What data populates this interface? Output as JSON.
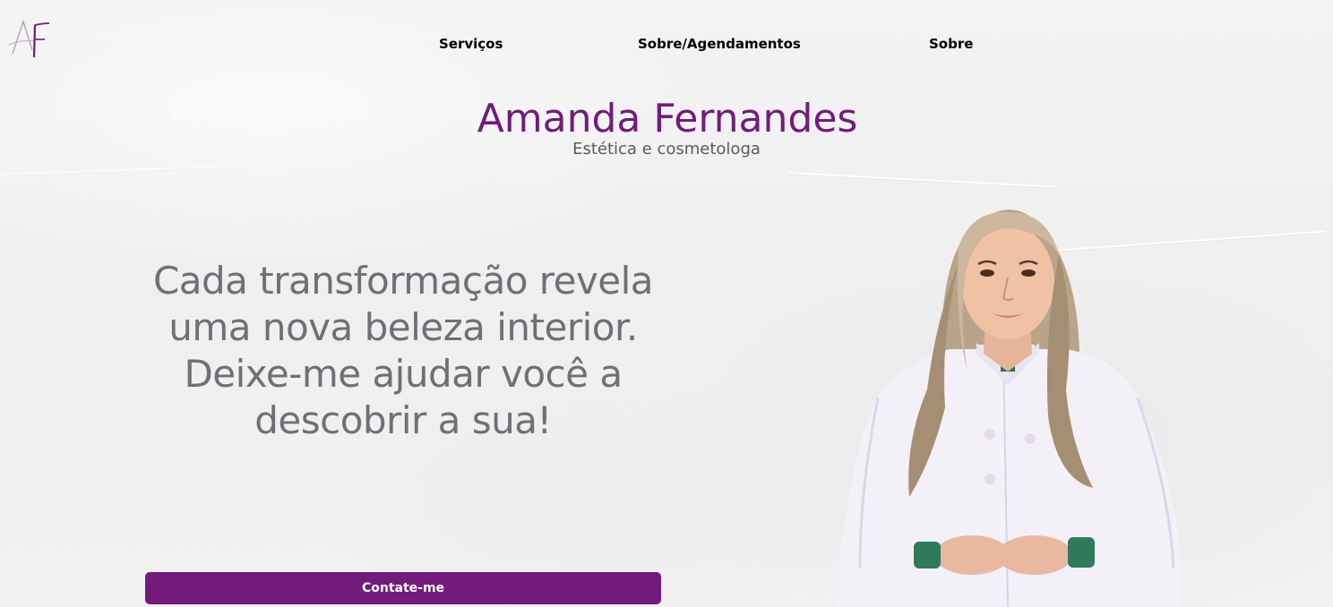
{
  "logo": {
    "text": "AF",
    "icon": "af-monogram-logo"
  },
  "nav": {
    "items": [
      {
        "label": "Serviços"
      },
      {
        "label": "Sobre/Agendamentos"
      },
      {
        "label": "Sobre"
      }
    ]
  },
  "hero": {
    "name": "Amanda Fernandes",
    "subtitle": "Estética e cosmetologa",
    "tagline": "Cada transformação revela uma nova beleza interior. Deixe-me ajudar você a descobrir a sua!",
    "cta_label": "Contate-me"
  },
  "colors": {
    "brand_purple": "#731b7a",
    "tagline_gray": "#6f6f76",
    "background": "#f1f1f1"
  }
}
